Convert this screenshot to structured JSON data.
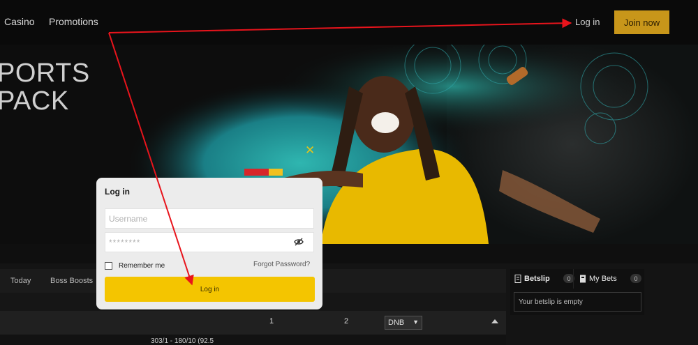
{
  "nav": {
    "items": [
      "Casino",
      "Promotions"
    ],
    "login_label": "Log in",
    "join_label": "Join now"
  },
  "banner": {
    "line1": "PORTS",
    "line2": "PACK",
    "close_symbol": "✕"
  },
  "sports_tabs": [
    "Today",
    "Boss Boosts"
  ],
  "odds_header": {
    "col1": "1",
    "col2": "2",
    "market_select": "DNB"
  },
  "match_row": {
    "score_text": "303/1 - 180/10 (92.5"
  },
  "betslip": {
    "tab_betslip": "Betslip",
    "betslip_count": "0",
    "tab_mybets": "My Bets",
    "mybets_count": "0",
    "empty_message": "Your betslip is empty"
  },
  "login_modal": {
    "title": "Log in",
    "username_placeholder": "Username",
    "password_value": "********",
    "remember_label": "Remember me",
    "forgot_label": "Forgot Password?",
    "submit_label": "Log in"
  },
  "colors": {
    "accent_yellow": "#f4c500",
    "join_button": "#c8961a",
    "annotation_arrow": "#e8141c"
  }
}
